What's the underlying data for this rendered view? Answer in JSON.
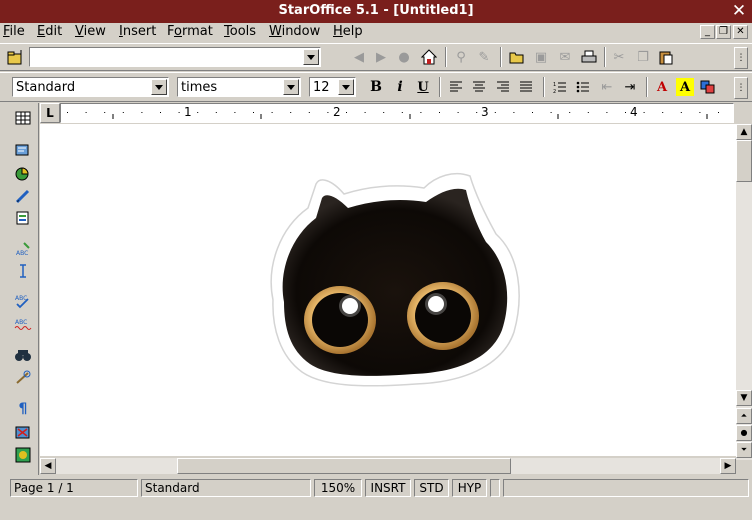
{
  "window": {
    "title": "StarOffice 5.1 - [Untitled1]",
    "close_glyph": "✕"
  },
  "menu": {
    "items": [
      {
        "u": "F",
        "rest": "ile"
      },
      {
        "u": "E",
        "rest": "dit"
      },
      {
        "u": "V",
        "rest": "iew"
      },
      {
        "u": "I",
        "rest": "nsert"
      },
      {
        "pre": "F",
        "u": "o",
        "rest": "rmat"
      },
      {
        "u": "T",
        "rest": "ools"
      },
      {
        "u": "W",
        "rest": "indow"
      },
      {
        "u": "H",
        "rest": "elp"
      }
    ],
    "doc_buttons": [
      "_",
      "❐",
      "✕"
    ]
  },
  "url_field": {
    "value": ""
  },
  "format": {
    "style": "Standard",
    "font": "times",
    "size": "12",
    "bold": "B",
    "italic": "i",
    "underline": "U",
    "font_color_label": "A",
    "highlight_label": "A"
  },
  "ruler": {
    "corner": "L",
    "marks": [
      "1",
      "2",
      "3",
      "4"
    ]
  },
  "document": {
    "image": "black-cat-face-sticker"
  },
  "status": {
    "page": "Page 1 / 1",
    "style": "Standard",
    "zoom": "150%",
    "insert_mode": "INSRT",
    "selection_mode": "STD",
    "hyperlink_mode": "HYP"
  },
  "colors": {
    "title_bar": "#7a1f1c",
    "chrome": "#d4d0c8",
    "font_color": "#c00000",
    "highlight": "#ffff00"
  }
}
